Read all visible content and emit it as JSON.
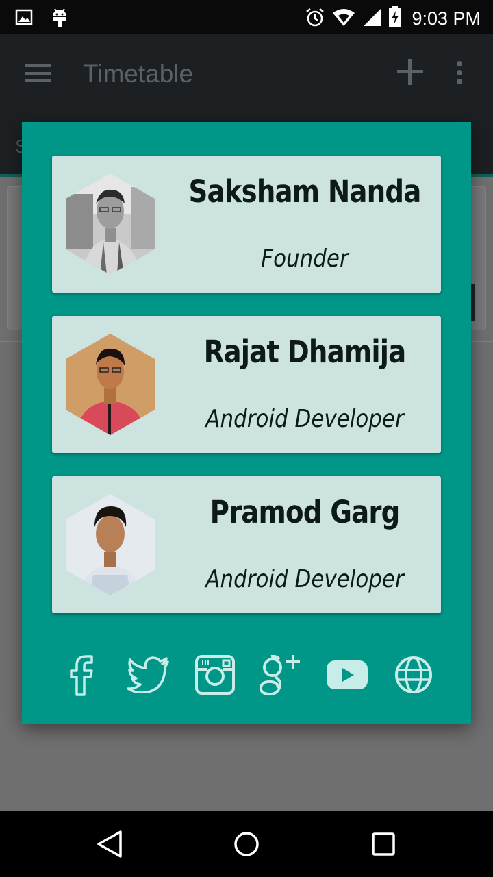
{
  "status_bar": {
    "time": "9:03 PM",
    "icons": [
      "image-icon",
      "android-icon",
      "alarm-icon",
      "wifi-icon",
      "signal-icon",
      "battery-charging-icon"
    ]
  },
  "toolbar": {
    "title": "Timetable",
    "tab_peek": "S",
    "icons": [
      "menu-icon",
      "add-icon",
      "more-vert-icon"
    ]
  },
  "dialog": {
    "members": [
      {
        "name": "Saksham Nanda",
        "role": "Founder",
        "avatar": "photo-saksham"
      },
      {
        "name": "Rajat Dhamija",
        "role": "Android Developer",
        "avatar": "photo-rajat"
      },
      {
        "name": "Pramod Garg",
        "role": "Android Developer",
        "avatar": "photo-pramod"
      }
    ],
    "social_icons": [
      "facebook-icon",
      "twitter-icon",
      "instagram-icon",
      "google-plus-icon",
      "youtube-icon",
      "website-globe-icon"
    ]
  },
  "colors": {
    "dialog_bg": "#009688",
    "card_bg": "#cde3e0",
    "toolbar_bg": "#1d2022",
    "icon_color": "#c8ece8"
  },
  "nav_bar": {
    "icons": [
      "back-icon",
      "home-icon",
      "recents-icon"
    ]
  }
}
